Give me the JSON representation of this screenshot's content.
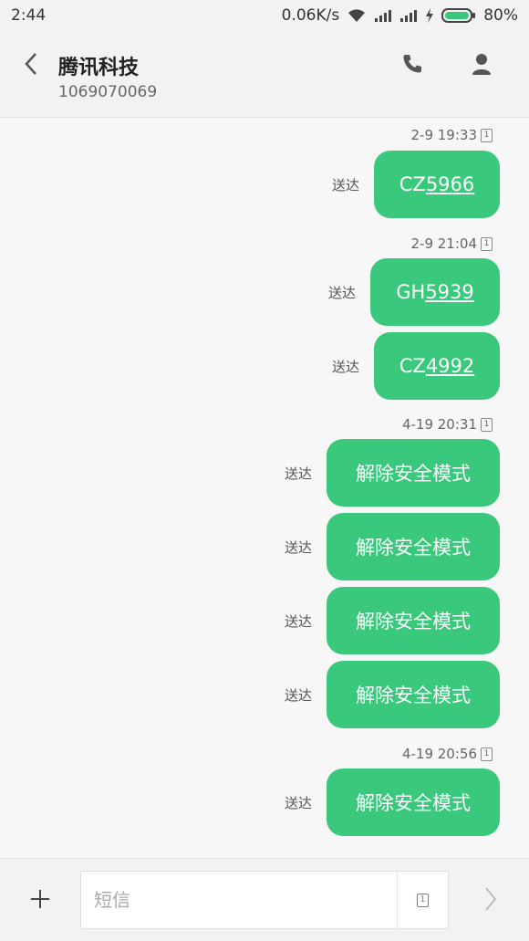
{
  "status_bar": {
    "time": "2:44",
    "network_speed": "0.06K/s",
    "battery": "80%",
    "icons": [
      "wifi-icon",
      "signal-icon",
      "signal-icon",
      "charging-icon",
      "battery-icon"
    ]
  },
  "header": {
    "contact_name": "腾讯科技",
    "contact_number": "1069070069",
    "icons": [
      "back-arrow-icon",
      "phone-icon",
      "contact-icon"
    ]
  },
  "thread": {
    "items": [
      {
        "type": "timestamp",
        "text": "2-9 19:33",
        "sim": "1"
      },
      {
        "type": "message",
        "status": "送达",
        "prefix": "CZ",
        "link": "5966"
      },
      {
        "type": "timestamp",
        "text": "2-9 21:04",
        "sim": "1"
      },
      {
        "type": "message",
        "status": "送达",
        "prefix": "GH",
        "link": "5939"
      },
      {
        "type": "message",
        "status": "送达",
        "prefix": "CZ",
        "link": "4992"
      },
      {
        "type": "timestamp",
        "text": "4-19 20:31",
        "sim": "1"
      },
      {
        "type": "message",
        "status": "送达",
        "text": "解除安全模式"
      },
      {
        "type": "message",
        "status": "送达",
        "text": "解除安全模式"
      },
      {
        "type": "message",
        "status": "送达",
        "text": "解除安全模式"
      },
      {
        "type": "message",
        "status": "送达",
        "text": "解除安全模式"
      },
      {
        "type": "timestamp",
        "text": "4-19 20:56",
        "sim": "1"
      },
      {
        "type": "message",
        "status": "送达",
        "text": "解除安全模式"
      }
    ]
  },
  "composer": {
    "placeholder": "短信",
    "value": "",
    "sim": "1",
    "icons": [
      "plus-icon",
      "sim-card-icon",
      "send-arrow-icon"
    ]
  },
  "colors": {
    "bubble": "#3ac97c",
    "background": "#f7f7f7",
    "bar": "#f2f2f2"
  }
}
